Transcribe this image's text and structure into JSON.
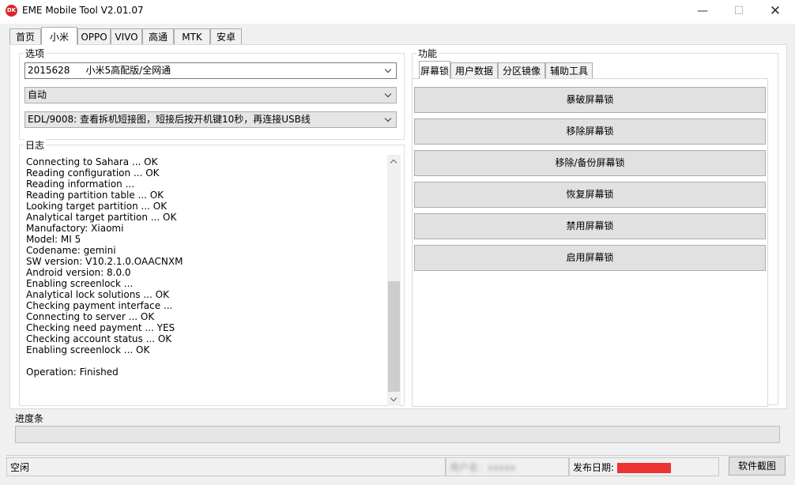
{
  "window": {
    "title": "EME Mobile Tool V2.01.07",
    "icon_text": "DK"
  },
  "top_tabs": [
    "首页",
    "小米",
    "OPPO",
    "VIVO",
    "高通",
    "MTK",
    "安卓"
  ],
  "options": {
    "title": "选项",
    "model_code": "2015628",
    "model_name": "小米5高配版/全网通",
    "mode": "自动",
    "edl": "EDL/9008: 查看拆机短接图，短接后按开机键10秒，再连接USB线"
  },
  "log": {
    "title": "日志",
    "lines": [
      "Connecting to Sahara ... OK",
      "Reading configuration ... OK",
      "Reading information ...",
      "Reading partition table ... OK",
      "Looking target partition ... OK",
      "Analytical target partition ... OK",
      "Manufactory: Xiaomi",
      "Model: MI 5",
      "Codename: gemini",
      "SW version: V10.2.1.0.OAACNXM",
      "Android version: 8.0.0",
      "Enabling screenlock ...",
      "Analytical lock solutions ... OK",
      "Checking payment interface ...",
      "Connecting to server ... OK",
      "Checking need payment ... YES",
      "Checking account status ... OK",
      "Enabling screenlock ... OK",
      "",
      "Operation: Finished"
    ]
  },
  "functions": {
    "title": "功能",
    "tabs": [
      "屏幕锁",
      "用户数据",
      "分区镜像",
      "辅助工具"
    ],
    "buttons": [
      "暴破屏幕锁",
      "移除屏幕锁",
      "移除/备份屏幕锁",
      "恢复屏幕锁",
      "禁用屏幕锁",
      "启用屏幕锁"
    ]
  },
  "progress": {
    "title": "进度条",
    "value": 0
  },
  "status": {
    "state": "空闲",
    "user": "用户名：xxxxx",
    "release_label": "发布日期:",
    "screenshot_button": "软件截图"
  }
}
